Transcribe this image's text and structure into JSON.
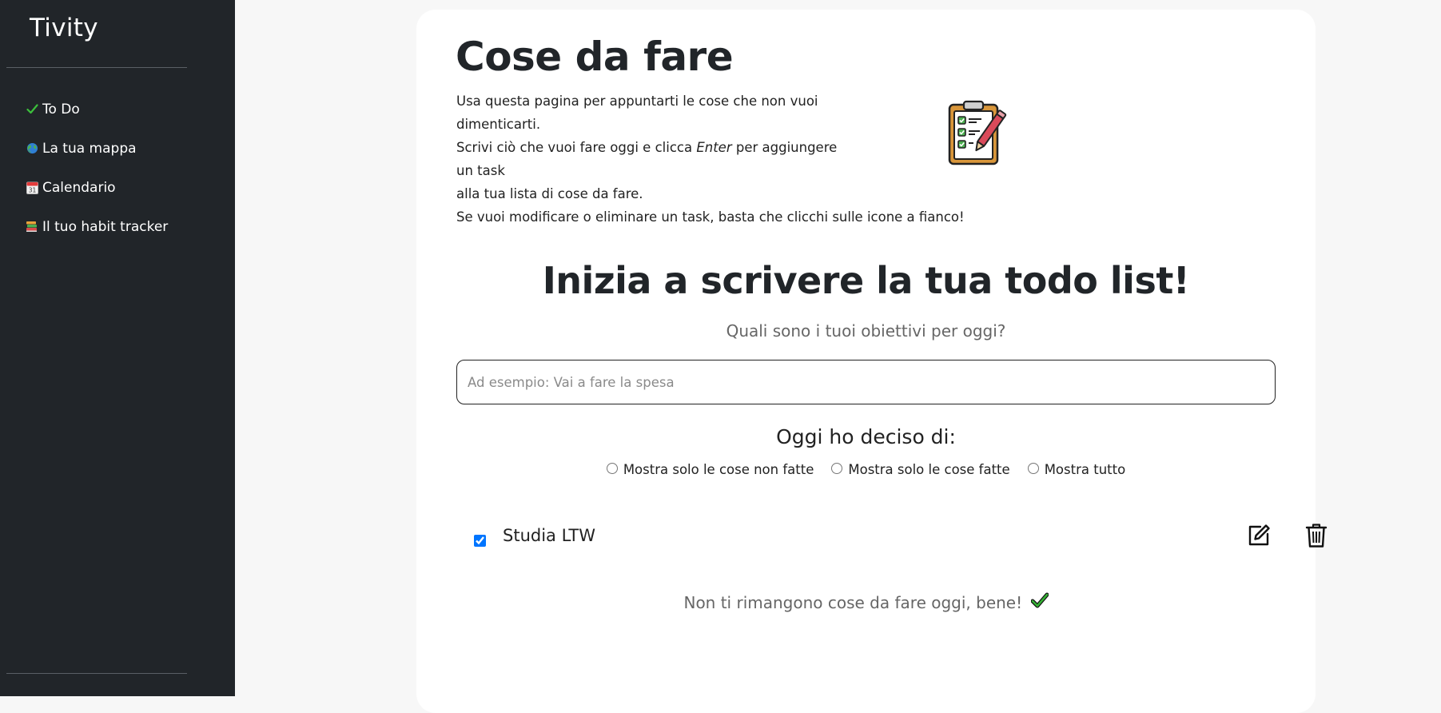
{
  "app": {
    "brand": "Tivity"
  },
  "sidebar": {
    "items": [
      {
        "icon": "check-icon",
        "label": "To Do"
      },
      {
        "icon": "globe-icon",
        "label": "La tua mappa"
      },
      {
        "icon": "calendar-icon",
        "label": "Calendario"
      },
      {
        "icon": "books-icon",
        "label": "Il tuo habit tracker"
      }
    ]
  },
  "main": {
    "title": "Cose da fare",
    "description": {
      "line1": "Usa questa pagina per appuntarti le cose che non vuoi dimenticarti.",
      "line2_before": "Scrivi ciò che vuoi fare oggi e clicca ",
      "line2_em": "Enter",
      "line2_after": " per aggiungere un task",
      "line3": "alla tua lista di cose da fare.",
      "line4": "Se vuoi modificare o eliminare un task, basta che clicchi sulle icone a fianco!"
    },
    "illustration_icon": "clipboard-checklist-icon",
    "hero_title": "Inizia a scrivere la tua todo list!",
    "hero_subtitle": "Quali sono i tuoi obiettivi per oggi?",
    "input": {
      "placeholder": "Ad esempio: Vai a fare la spesa",
      "value": ""
    },
    "filter_title": "Oggi ho deciso di:",
    "filters": [
      {
        "label": "Mostra solo le cose non fatte",
        "checked": false
      },
      {
        "label": "Mostra solo le cose fatte",
        "checked": false
      },
      {
        "label": "Mostra tutto",
        "checked": false
      }
    ],
    "tasks": [
      {
        "label": "Studia LTW",
        "done": true,
        "edit_icon": "edit-icon",
        "delete_icon": "trash-icon"
      }
    ],
    "empty_message": "Non ti rimangono cose da fare oggi, bene!",
    "colors": {
      "sidebar_bg": "#212529",
      "success_green": "#2e9e2e"
    }
  }
}
